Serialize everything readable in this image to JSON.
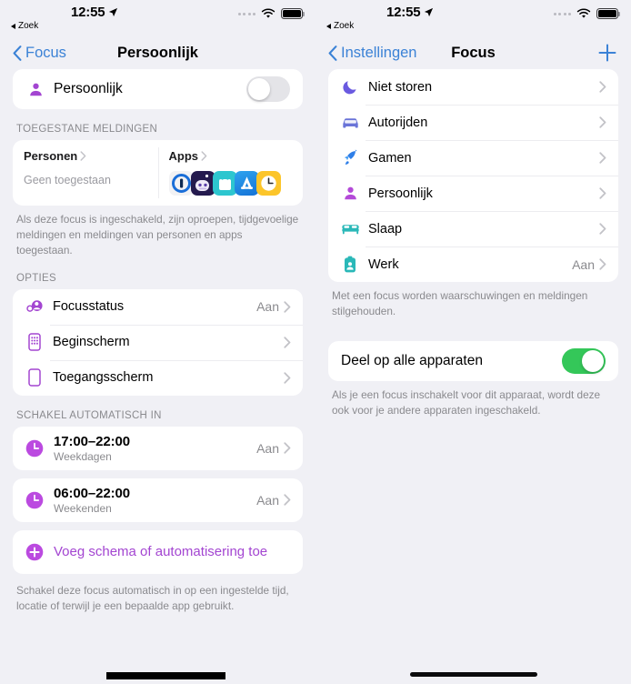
{
  "status_bar": {
    "time": "12:55",
    "back_label": "Zoek",
    "location_icon": "location-arrow-icon",
    "signal_icon": "signal-dots-icon",
    "wifi_icon": "wifi-icon",
    "battery_icon": "battery-full-icon"
  },
  "left": {
    "nav": {
      "back_label": "Focus",
      "title": "Persoonlijk"
    },
    "focus_toggle": {
      "label": "Persoonlijk",
      "icon": "person-icon",
      "state": "off",
      "color": "#a345d1"
    },
    "allowed": {
      "header": "TOEGESTANE MELDINGEN",
      "people": {
        "title": "Personen",
        "subtitle": "Geen toegestaan"
      },
      "apps": {
        "title": "Apps",
        "icons": [
          "onepassword-app-icon",
          "robot-app-icon",
          "shopping-bag-app-icon",
          "app-store-app-icon",
          "clock-app-icon"
        ]
      },
      "footnote": "Als deze focus is ingeschakeld, zijn oproepen, tijdgevoelige meldingen en meldingen van personen en apps toegestaan."
    },
    "options": {
      "header": "OPTIES",
      "items": [
        {
          "label": "Focusstatus",
          "value": "Aan",
          "icon": "focus-status-icon"
        },
        {
          "label": "Beginscherm",
          "value": "",
          "icon": "home-screen-icon"
        },
        {
          "label": "Toegangsscherm",
          "value": "",
          "icon": "lock-screen-icon"
        }
      ]
    },
    "schedule": {
      "header": "SCHAKEL AUTOMATISCH IN",
      "items": [
        {
          "time": "17:00–22:00",
          "days": "Weekdagen",
          "value": "Aan",
          "icon": "clock-icon"
        },
        {
          "time": "06:00–22:00",
          "days": "Weekenden",
          "value": "Aan",
          "icon": "clock-icon"
        }
      ],
      "add_label": "Voeg schema of automatisering toe",
      "add_icon": "plus-circle-icon",
      "footnote": "Schakel deze focus automatisch in op een ingestelde tijd, locatie of terwijl je een bepaalde app gebruikt."
    }
  },
  "right": {
    "nav": {
      "back_label": "Instellingen",
      "title": "Focus",
      "add_icon": "plus-icon"
    },
    "focus_list": [
      {
        "label": "Niet storen",
        "value": "",
        "icon": "moon-icon",
        "color": "#6a5ae0"
      },
      {
        "label": "Autorijden",
        "value": "",
        "icon": "car-icon",
        "color": "#6a74d8"
      },
      {
        "label": "Gamen",
        "value": "",
        "icon": "rocket-icon",
        "color": "#2f7fe8"
      },
      {
        "label": "Persoonlijk",
        "value": "",
        "icon": "person-icon",
        "color": "#b44ad8"
      },
      {
        "label": "Slaap",
        "value": "",
        "icon": "bed-icon",
        "color": "#2ab8b8"
      },
      {
        "label": "Werk",
        "value": "Aan",
        "icon": "badge-icon",
        "color": "#2ab8b8"
      }
    ],
    "list_footnote": "Met een focus worden waarschuwingen en meldingen stilgehouden.",
    "share_toggle": {
      "label": "Deel op alle apparaten",
      "state": "on"
    },
    "share_footnote": "Als je een focus inschakelt voor dit apparaat, wordt deze ook voor je andere apparaten ingeschakeld."
  },
  "colors": {
    "accent_blue": "#3b82d6",
    "purple": "#a345d1",
    "green": "#34c759",
    "teal": "#2ab8b8"
  }
}
